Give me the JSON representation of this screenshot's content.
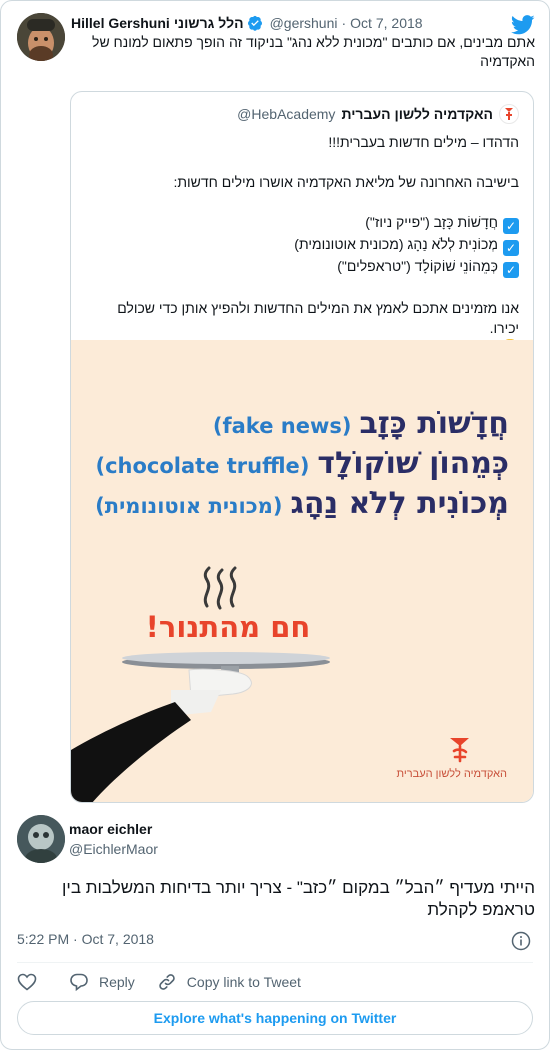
{
  "author": {
    "name_en": "Hillel Gershuni",
    "name_he": "הלל גרשוני",
    "handle": "@gershuni",
    "date": "Oct 7, 2018",
    "text": "אתם מבינים, אם כותבים \"מכונית ללא נהג\" בניקוד זה הופך פתאום למונח של האקדמיה"
  },
  "quoted": {
    "name": "האקדמיה ללשון העברית",
    "handle": "@HebAcademy",
    "line1": "הדהדו – מילים חדשות בעברית!!!",
    "line2": "בישיבה האחרונה של מליאת האקדמיה אושרו מילים חדשות:",
    "items": [
      "חֲדָשׁוֹת כָּזָב (\"פייק ניוז\")",
      "מְכוֹנִית לְלֹא נַהָג (מכונית אוטונומית)",
      "כְּמֵהוֹנֵי שׁוֹקוֹלָד (\"טראפלים\")"
    ],
    "line3": "אנו מזמינים אתכם לאמץ את המילים החדשות ולהפיץ אותן כדי שכולם יכירו."
  },
  "poster": {
    "rows": [
      {
        "he": "חֲדָשׁוֹת כָּזָב",
        "en": "(fake news)"
      },
      {
        "he": "כְּמֵהוֹן שׁוֹקוֹלָד",
        "en": "(chocolate truffle)"
      },
      {
        "he": "מְכוֹנִית לְלֹא נַהָג",
        "en": "(מכונית אוטונומית)"
      }
    ],
    "hot_text": "חם מהתנור!",
    "academy_label": "האקדמיה ללשון העברית"
  },
  "reply": {
    "name": "maor eichler",
    "handle": "@EichlerMaor",
    "text": "הייתי מעדיף ״הבל״ במקום ״כזב\" - צריך יותר בדיחות המשלבות בין טראמפ לקהלת"
  },
  "meta": {
    "time": "5:22 PM · Oct 7, 2018"
  },
  "actions": {
    "reply": "Reply",
    "copy": "Copy link to Tweet"
  },
  "explore": "Explore what's happening on Twitter",
  "colors": {
    "twitter_blue": "#1d9bf0",
    "poster_bg": "#fcebd8",
    "poster_navy": "#2a2d66",
    "poster_blue": "#2a7cc7",
    "poster_red": "#e8442b"
  }
}
